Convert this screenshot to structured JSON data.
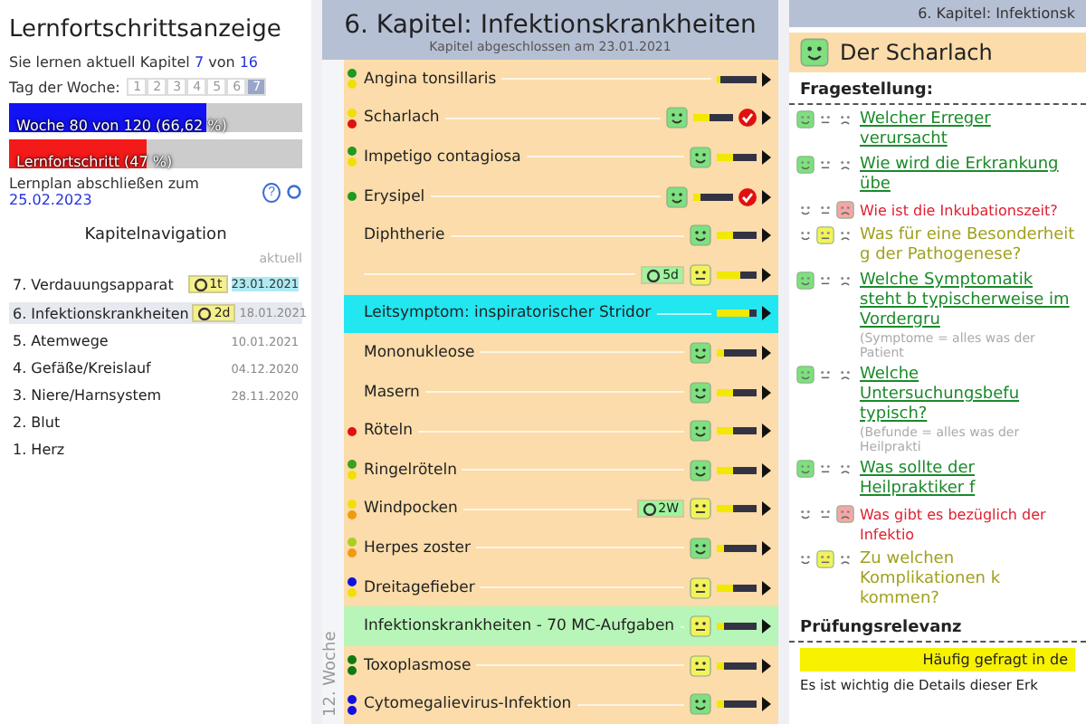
{
  "progress_panel": {
    "title": "Lernfortschrittsanzeige",
    "chapter_line": {
      "prefix": "Sie lernen aktuell Kapitel",
      "current": "7",
      "sep": "von",
      "total": "16"
    },
    "weekday": {
      "label": "Tag der Woche:",
      "days": [
        {
          "label": "1",
          "selected": false
        },
        {
          "label": "2",
          "selected": false
        },
        {
          "label": "3",
          "selected": false
        },
        {
          "label": "4",
          "selected": false
        },
        {
          "label": "5",
          "selected": false
        },
        {
          "label": "6",
          "selected": false
        },
        {
          "label": "7",
          "selected": true
        }
      ]
    },
    "bars": [
      {
        "label": "Woche 80 von 120 (66,62 %)",
        "level": 0.67,
        "color": "#1212f5"
      },
      {
        "label": "Lernfortschritt (47 %)",
        "level": 0.47,
        "color": "#f51a1a"
      }
    ],
    "finish": {
      "prefix": "Lernplan abschließen zum",
      "date": "25.02.2023"
    },
    "help": "?",
    "nav": {
      "title": "Kapitelnavigation",
      "date_header": "aktuell",
      "items": [
        {
          "label": "7. Verdauungsapparat",
          "date": "23.01.2021",
          "selected": false,
          "current": true,
          "badge": "1t"
        },
        {
          "label": "6. Infektionskrankheiten",
          "date": "18.01.2021",
          "selected": true,
          "current": false,
          "badge": "2d"
        },
        {
          "label": "5. Atemwege",
          "date": "10.01.2021",
          "selected": false,
          "current": false
        },
        {
          "label": "4. Gefäße/Kreislauf",
          "date": "04.12.2020",
          "selected": false,
          "current": false
        },
        {
          "label": "3. Niere/Harnsystem",
          "date": "28.11.2020",
          "selected": false,
          "current": false
        },
        {
          "label": "2. Blut",
          "selected": false
        },
        {
          "label": "1. Herz",
          "selected": false
        }
      ]
    }
  },
  "chapter_panel": {
    "title": "6. Kapitel: Infektionskrankheiten",
    "subtitle": "Kapitel abgeschlossen am 23.01.2021",
    "week_label": "12. Woche",
    "rows": [
      {
        "kind": "topic",
        "name": "Angina tonsillaris",
        "dots": [
          {
            "color": "#1e9a1e"
          },
          {
            "color": "#f0e000"
          }
        ],
        "level": 0.1
      },
      {
        "kind": "topic",
        "name": "Scharlach",
        "dots": [
          {
            "color": "#f0e000"
          },
          {
            "color": "#e01010"
          }
        ],
        "face": {
          "kind": "good"
        },
        "level": 0.4,
        "done": true
      },
      {
        "kind": "topic",
        "name": "Impetigo contagiosa",
        "dots": [
          {
            "color": "#1e9a1e"
          },
          {
            "color": "#f0e000"
          }
        ],
        "face": {
          "kind": "good"
        },
        "level": 0.4
      },
      {
        "kind": "topic",
        "name": "Erysipel",
        "dots": [
          {
            "color": "#1e9a1e"
          }
        ],
        "face": {
          "kind": "good"
        },
        "level": 0.2,
        "done": true
      },
      {
        "kind": "topic",
        "name": "Diphtherie",
        "dots": [],
        "face": {
          "kind": "good"
        },
        "level": 0.4
      },
      {
        "kind": "topic",
        "name": "",
        "dots": [],
        "face": {
          "kind": "meh"
        },
        "level": 0.6,
        "badge": "5d"
      },
      {
        "kind": "leitsymptom",
        "name": "Leitsymptom: inspiratorischer Stridor",
        "dots": [],
        "level": 0.8
      },
      {
        "kind": "topic",
        "name": "Mononukleose",
        "dots": [],
        "face": {
          "kind": "good"
        },
        "level": 0.2
      },
      {
        "kind": "topic",
        "name": "Masern",
        "dots": [],
        "face": {
          "kind": "good"
        },
        "level": 0.4
      },
      {
        "kind": "topic",
        "name": "Röteln",
        "dots": [
          {
            "color": "#e01010"
          }
        ],
        "face": {
          "kind": "good"
        },
        "level": 0.4
      },
      {
        "kind": "topic",
        "name": "Ringelröteln",
        "dots": [
          {
            "color": "#3aa01e"
          },
          {
            "color": "#f0e000"
          }
        ],
        "face": {
          "kind": "good"
        },
        "level": 0.4
      },
      {
        "kind": "topic",
        "name": "Windpocken",
        "dots": [
          {
            "color": "#f0e000"
          },
          {
            "color": "#f09a10"
          }
        ],
        "face": {
          "kind": "meh"
        },
        "level": 0.4,
        "badge": "2W"
      },
      {
        "kind": "topic",
        "name": "Herpes zoster",
        "dots": [
          {
            "color": "#a8d020"
          },
          {
            "color": "#f09a10"
          }
        ],
        "face": {
          "kind": "good"
        },
        "level": 0.2
      },
      {
        "kind": "topic",
        "name": "Dreitagefieber",
        "dots": [
          {
            "color": "#1010e0"
          },
          {
            "color": "#f0e000"
          }
        ],
        "face": {
          "kind": "meh"
        },
        "level": 0.4
      },
      {
        "kind": "quiz",
        "name": "Infektionskrankheiten - 70 MC-Aufgaben",
        "dots": [],
        "face": {
          "kind": "meh"
        },
        "level": 0.2
      },
      {
        "kind": "topic",
        "name": "Toxoplasmose",
        "dots": [
          {
            "color": "#107a10"
          },
          {
            "color": "#107a10"
          }
        ],
        "face": {
          "kind": "meh"
        },
        "level": 0.2
      },
      {
        "kind": "topic",
        "name": "Cytomegalievirus-Infektion",
        "dots": [
          {
            "color": "#1010e0"
          },
          {
            "color": "#1010e0"
          }
        ],
        "face": {
          "kind": "good"
        },
        "level": 0.2
      }
    ]
  },
  "topic_panel": {
    "breadcrumb": "6. Kapitel: Infektionsk",
    "title": "Der Scharlach",
    "face": {
      "kind": "good"
    },
    "question_heading": "Fragestellung:",
    "questions": [
      {
        "text": "Welcher Erreger verursacht",
        "kind": "good"
      },
      {
        "text": "Wie wird die Erkrankung übe",
        "kind": "good"
      },
      {
        "text": "Wie ist die Inkubationszeit?",
        "kind": "bad"
      },
      {
        "text": "Was für eine Besonderheit g der Pathogenese?",
        "kind": "meh"
      },
      {
        "text": "Welche Symptomatik steht b typischerweise im Vordergru",
        "note": "(Symptome = alles was der Patient",
        "kind": "good"
      },
      {
        "text": "Welche Untersuchungsbefu typisch?",
        "note": "(Befunde = alles was der Heilprakti",
        "kind": "good"
      },
      {
        "text": "Was sollte der Heilpraktiker f",
        "kind": "good"
      },
      {
        "text": "Was gibt es bezüglich der Infektio",
        "kind": "bad"
      },
      {
        "text": "Zu welchen Komplikationen k kommen?",
        "kind": "meh"
      }
    ],
    "relevance_heading": "Prüfungsrelevanz",
    "relevance_badge": "Häufig gefragt in de",
    "relevance_text": "Es ist wichtig die Details dieser Erk"
  }
}
